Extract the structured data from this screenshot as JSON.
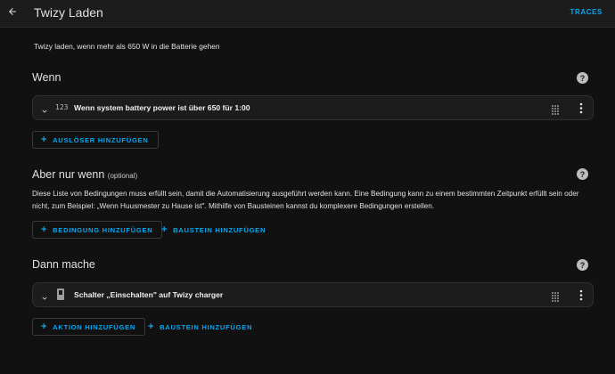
{
  "header": {
    "title": "Twizy Laden",
    "traces_label": "TRACES"
  },
  "description": "Twizy laden, wenn mehr als 650 W in die Batterie gehen",
  "triggers": {
    "title": "Wenn",
    "items": [
      {
        "type_icon_text": "123",
        "label": "Wenn system battery power ist über 650 für 1:00"
      }
    ],
    "add_label": "AUSLÖSER HINZUFÜGEN"
  },
  "conditions": {
    "title": "Aber nur wenn",
    "optional_label": "(optional)",
    "description": "Diese Liste von Bedingungen muss erfüllt sein, damit die Automatisierung ausgeführt werden kann. Eine Bedingung kann zu einem bestimmten Zeitpunkt erfüllt sein oder nicht, zum Beispiel: „Wenn Huusmester zu Hause ist\". Mithilfe von Bausteinen kannst du komplexere Bedingungen erstellen.",
    "add_label": "BEDINGUNG HINZUFÜGEN",
    "add_building_block_label": "BAUSTEIN HINZUFÜGEN"
  },
  "actions": {
    "title": "Dann mache",
    "items": [
      {
        "label": "Schalter „Einschalten\" auf Twizy charger"
      }
    ],
    "add_label": "AKTION HINZUFÜGEN",
    "add_building_block_label": "BAUSTEIN HINZUFÜGEN"
  },
  "icons": {
    "back": "arrow-left-icon",
    "help": "help-circle-icon",
    "chevron": "chevron-down-icon",
    "drag": "drag-handle-icon",
    "more": "dots-vertical-icon",
    "device": "power-socket-icon",
    "plus": "plus-icon"
  },
  "colors": {
    "background": "#111111",
    "card": "#1c1c1c",
    "accent": "#03a9f4",
    "text": "#e1e1e1"
  }
}
